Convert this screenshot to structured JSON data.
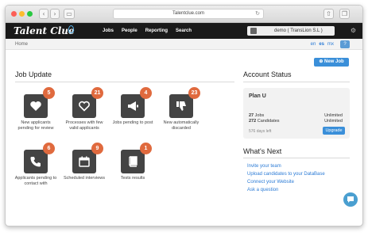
{
  "browser": {
    "url": "Talentclue.com"
  },
  "app": {
    "logo": "Talent Clue"
  },
  "nav": {
    "items": [
      "Jobs",
      "People",
      "Reporting",
      "Search"
    ]
  },
  "user": {
    "label": "demo ( TransLion S.L )"
  },
  "breadcrumb": {
    "home": "Home"
  },
  "languages": {
    "items": [
      "en",
      "es",
      "mx"
    ],
    "active": "es"
  },
  "help": {
    "label": "?"
  },
  "job_update": {
    "title": "Job Update",
    "tiles": [
      {
        "icon": "heart-filled-icon",
        "count": "5",
        "label": "New applicants pending for review"
      },
      {
        "icon": "heart-outline-icon",
        "count": "21",
        "label": "Processes with few valid applicants"
      },
      {
        "icon": "megaphone-icon",
        "count": "4",
        "label": "Jobs pending to post"
      },
      {
        "icon": "thumbs-down-icon",
        "count": "23",
        "label": "New automatically discarded"
      },
      {
        "icon": "phone-icon",
        "count": "6",
        "label": "Applicants pending to contact with"
      },
      {
        "icon": "calendar-icon",
        "count": "9",
        "label": "Scheduled interviews"
      },
      {
        "icon": "book-icon",
        "count": "1",
        "label": "Tests results"
      }
    ]
  },
  "new_job": {
    "label": "New Job"
  },
  "account": {
    "title": "Account Status",
    "plan": "Plan U",
    "jobs_count": "27",
    "jobs_label": "Jobs",
    "jobs_limit": "Unlimited",
    "candidates_count": "272",
    "candidates_label": "Candidates",
    "candidates_limit": "Unlimited",
    "days_left": "576 days left",
    "upgrade": "Upgrade"
  },
  "whats_next": {
    "title": "What's Next",
    "links": [
      "Invite your team",
      "Upload candidates to your DataBase",
      "Connect your Website",
      "Ask a question"
    ]
  },
  "colors": {
    "accent": "#3a8fd9",
    "badge": "#e06a3e",
    "tile": "#444444"
  }
}
